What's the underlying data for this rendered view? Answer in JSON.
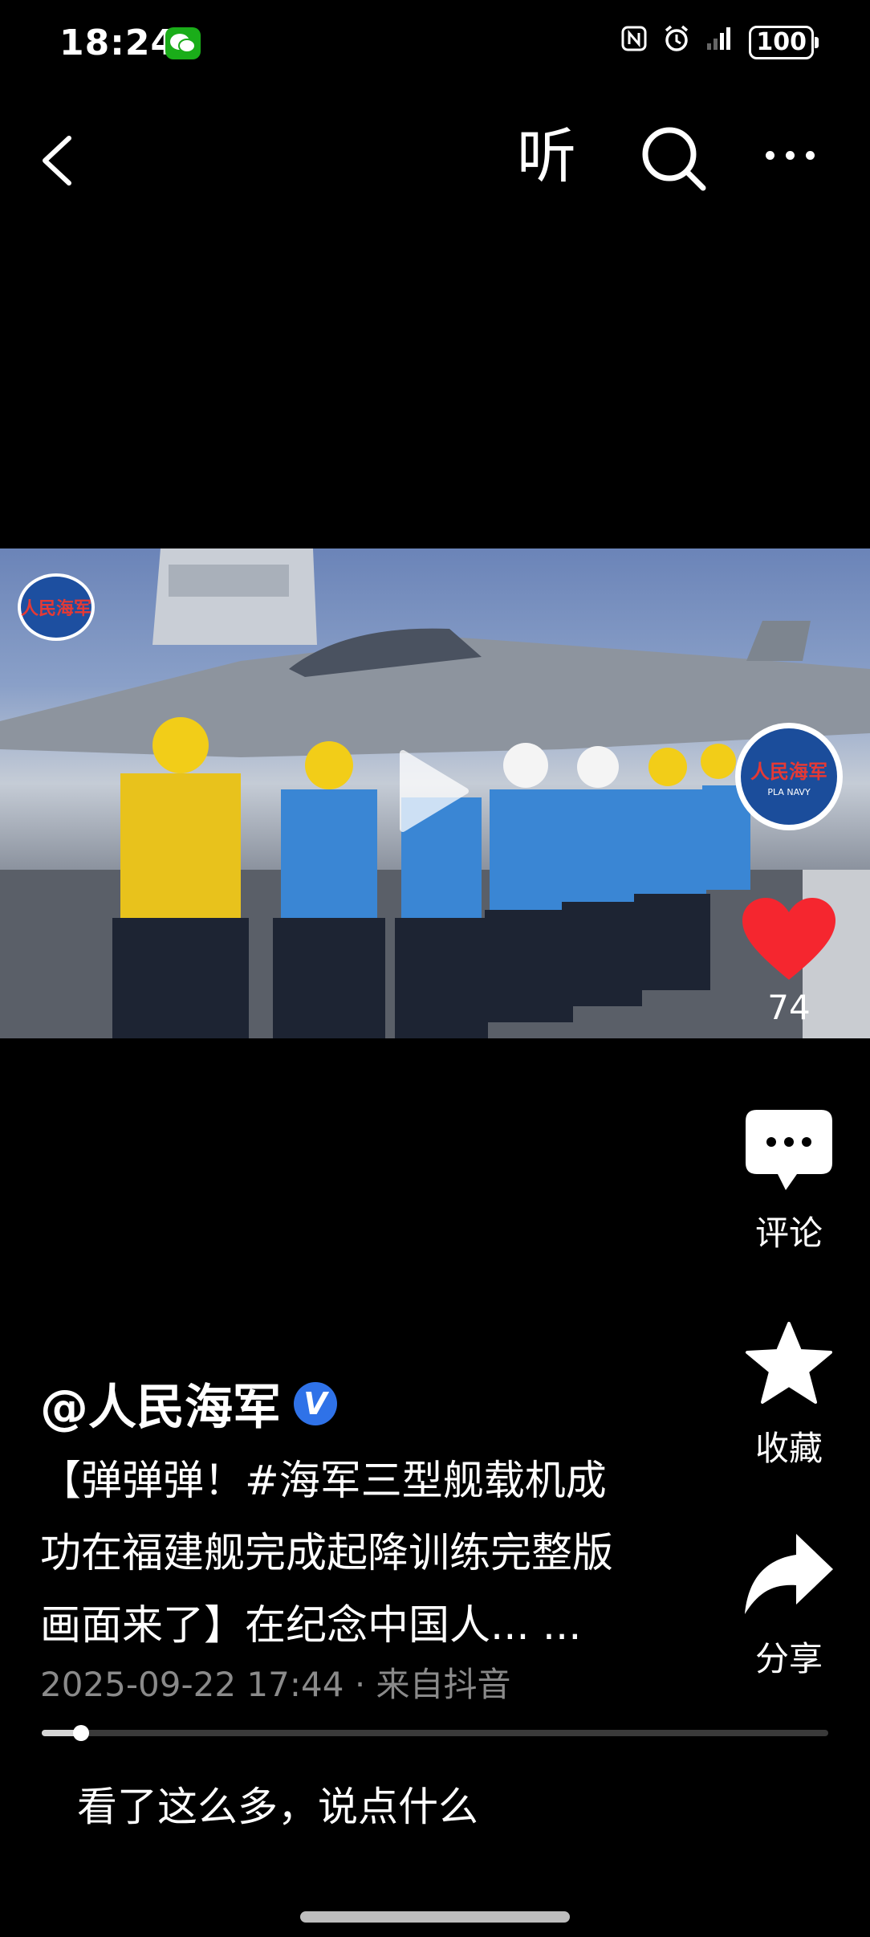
{
  "status_bar": {
    "time": "18:24",
    "battery": "100",
    "icons": [
      "wechat-icon",
      "nfc-icon",
      "alarm-icon",
      "signal-icon",
      "battery-icon"
    ]
  },
  "nav": {
    "listen_label": "听",
    "icons": [
      "back-icon",
      "search-icon",
      "more-icon"
    ]
  },
  "video": {
    "channel_logo_text": "人民海军",
    "progress": 0.05
  },
  "actions": {
    "avatar_text": "人民海军",
    "avatar_subtext": "PLA NAVY",
    "like_count": "74",
    "comment_label": "评论",
    "favorite_label": "收藏",
    "share_label": "分享"
  },
  "post": {
    "author": "@人民海军",
    "verified_mark": "V",
    "desc_lines": [
      "【弹弹弹！#海军三型舰载机成",
      "功在福建舰完成起降训练完整版",
      "画面来了】在纪念中国人... ..."
    ],
    "meta": "2025-09-22 17:44 · 来自抖音"
  },
  "comment": {
    "placeholder": "看了这么多，说点什么"
  },
  "colors": {
    "background": "#000000",
    "like_red": "#f5262f",
    "verified_blue": "#2f72e8",
    "meta_gray": "#8a8a8a"
  }
}
